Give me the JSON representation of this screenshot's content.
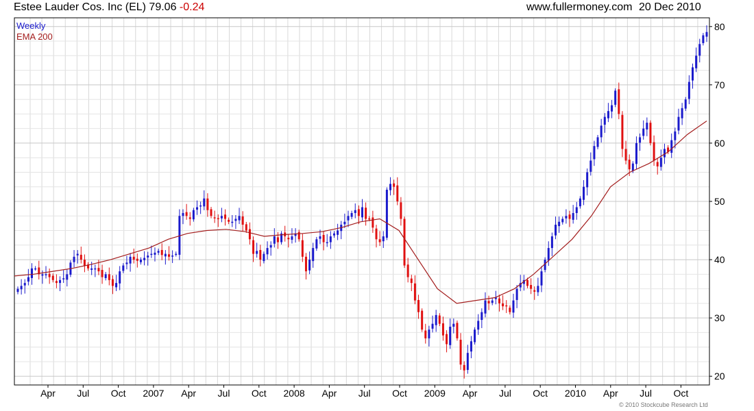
{
  "header": {
    "ticker_text": "Estee Lauder Cos. Inc (EL) 79.06",
    "change": "-0.24",
    "site": "www.fullermoney.com",
    "date": "20 Dec 2010"
  },
  "credit": "© 2010 Stockcube Research Ltd",
  "colors": {
    "up": "#1a1acc",
    "down": "#e01010",
    "ema": "#a31c1c",
    "grid": "#d8d8d8",
    "legend_weekly": "#1a1acc",
    "legend_ema": "#a31c1c"
  },
  "chart_data": {
    "type": "candlestick",
    "title": "Estee Lauder Cos. Inc (EL) 79.06 -0.24",
    "legend": [
      "Weekly",
      "EMA 200"
    ],
    "x_tick_labels": [
      "Apr",
      "Jul",
      "Oct",
      "2007",
      "Apr",
      "Jul",
      "Oct",
      "2008",
      "Apr",
      "Jul",
      "Oct",
      "2009",
      "Apr",
      "Jul",
      "Oct",
      "2010",
      "Apr",
      "Jul",
      "Oct"
    ],
    "y_ticks": [
      20,
      30,
      40,
      50,
      60,
      70,
      80
    ],
    "ylim": [
      18.5,
      81.5
    ],
    "grid": true,
    "approx_weekly_close": [
      35,
      35.5,
      36,
      37,
      38.5,
      38.5,
      37.5,
      37.5,
      37.5,
      37,
      36.5,
      36,
      36.5,
      36.8,
      37.5,
      39.5,
      40.5,
      41,
      40,
      39,
      38.5,
      38.5,
      38.5,
      38,
      37,
      37.5,
      36.5,
      35.5,
      36,
      38,
      39,
      39.5,
      40.5,
      40,
      39.8,
      40,
      40.3,
      40.7,
      41,
      41.2,
      41.5,
      40.8,
      41,
      40.5,
      40.7,
      41,
      47.5,
      48,
      47.5,
      47,
      48.5,
      49,
      49.3,
      50.5,
      48.5,
      47.5,
      47.2,
      47,
      47.5,
      47,
      46.5,
      46.5,
      47,
      47.5,
      46,
      45,
      43.5,
      41,
      41.5,
      40,
      41,
      42,
      42.5,
      44,
      43,
      44.5,
      44,
      43.5,
      44,
      44.5,
      43.5,
      40.5,
      38,
      40,
      42,
      43.5,
      44,
      43,
      43,
      44,
      44.5,
      45,
      46,
      46.5,
      47.5,
      48,
      48.5,
      47.5,
      49,
      47,
      47,
      45.5,
      43.5,
      43,
      44,
      52,
      53,
      52.5,
      50,
      47,
      39,
      37,
      36,
      33,
      31,
      28,
      26.5,
      28,
      29,
      30.5,
      29,
      27,
      25.5,
      28.5,
      29,
      26.5,
      22,
      21,
      24,
      26,
      28,
      29.5,
      31,
      33,
      32.5,
      33,
      33.5,
      32.5,
      32,
      32,
      31,
      33,
      35,
      36,
      36.5,
      35.5,
      35,
      34.5,
      35.5,
      38,
      40,
      42,
      44,
      46,
      46.5,
      47,
      47.5,
      47,
      48,
      49,
      50.5,
      52.5,
      55,
      57,
      59.5,
      61,
      63,
      64.5,
      65.5,
      66.5,
      69,
      65,
      59,
      57,
      55.5,
      56.5,
      60,
      61,
      62.5,
      63.5,
      60,
      57,
      56,
      57.5,
      59,
      58.5,
      60.5,
      62,
      64.5,
      66,
      67.5,
      70.5,
      73,
      75,
      77,
      78.5,
      79.06
    ],
    "approx_ema200": [
      37.2,
      37.5,
      38,
      38.5,
      39.2,
      40,
      41,
      42,
      43.5,
      44.5,
      45,
      45.2,
      44.8,
      44,
      44.3,
      44.5,
      44.8,
      45.5,
      46.5,
      47,
      45,
      40,
      35,
      32.5,
      33,
      33.5,
      35,
      37.5,
      40.5,
      43.5,
      47.5,
      52.5,
      55,
      56.5,
      58.5,
      61.5,
      63.8
    ]
  }
}
